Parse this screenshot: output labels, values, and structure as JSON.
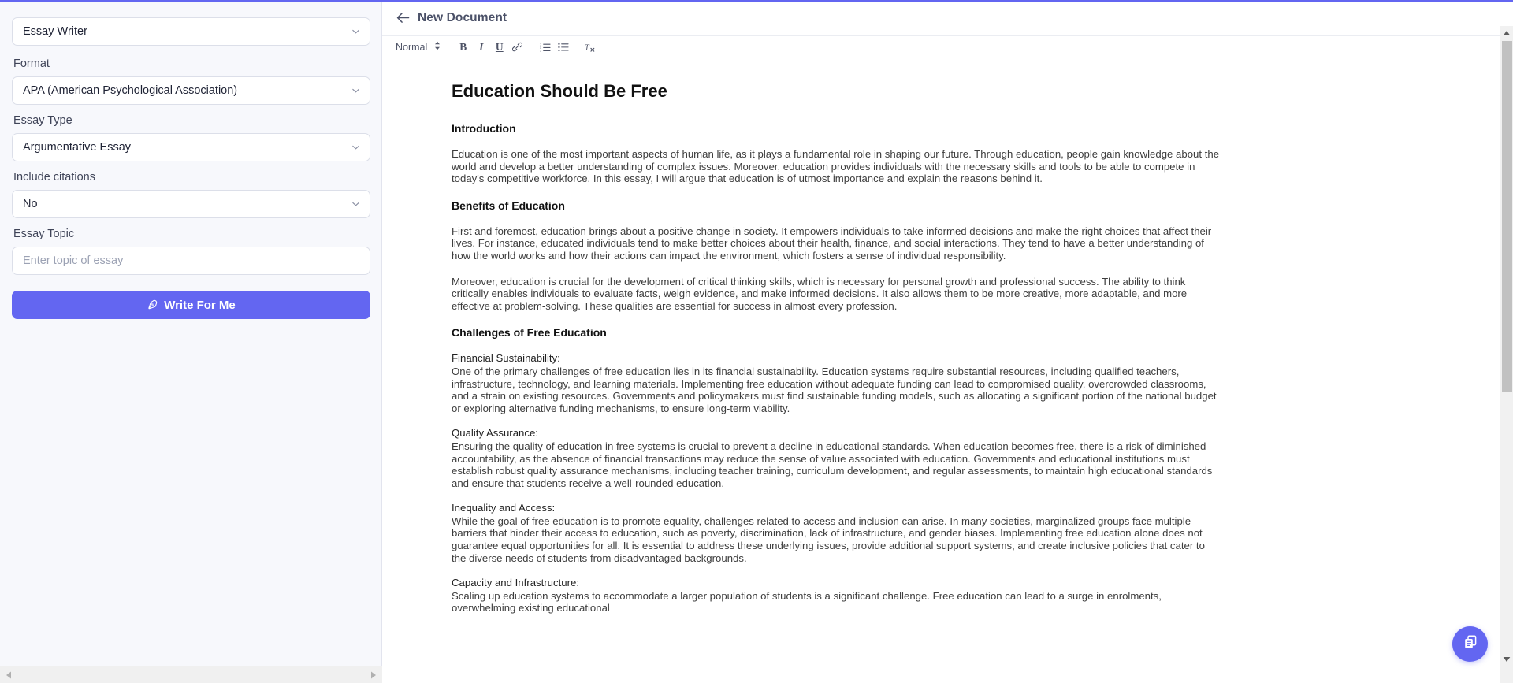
{
  "theme": {
    "accent": "#6366f1",
    "sidebar_bg": "#f7f8fc",
    "text": "#1f2335"
  },
  "sidebar": {
    "tool_select": {
      "value": "Essay Writer",
      "icon": "chevron-down-icon"
    },
    "fields": [
      {
        "label": "Format",
        "value": "APA (American Psychological Association)",
        "type": "select"
      },
      {
        "label": "Essay Type",
        "value": "Argumentative Essay",
        "type": "select"
      },
      {
        "label": "Include citations",
        "value": "No",
        "type": "select"
      }
    ],
    "topic": {
      "label": "Essay Topic",
      "value": "",
      "placeholder": "Enter topic of essay"
    },
    "submit": {
      "label": "Write For Me",
      "icon": "pen-nib-icon"
    },
    "scrollbar": {
      "left_arrow": "triangle-left-icon",
      "right_arrow": "triangle-right-icon"
    }
  },
  "editor": {
    "back_icon": "arrow-left-icon",
    "title": "New Document",
    "toolbar": {
      "style_value": "Normal",
      "style_icon": "updown-chevron-icon",
      "buttons": [
        {
          "name": "bold",
          "glyph": "B",
          "icon": "bold-icon"
        },
        {
          "name": "italic",
          "glyph": "I",
          "icon": "italic-icon"
        },
        {
          "name": "underline",
          "glyph": "U",
          "icon": "underline-icon"
        },
        {
          "name": "link",
          "glyph": "",
          "icon": "link-icon"
        },
        {
          "name": "ordered-list",
          "glyph": "",
          "icon": "ordered-list-icon"
        },
        {
          "name": "bullet-list",
          "glyph": "",
          "icon": "bullet-list-icon"
        },
        {
          "name": "clear-format",
          "glyph": "",
          "icon": "clear-format-icon"
        }
      ]
    }
  },
  "document": {
    "title": "Education Should Be Free",
    "sections": {
      "intro_heading": "Introduction",
      "intro_para": "Education is one of the most important aspects of human life, as it plays a fundamental role in shaping our future. Through education, people gain knowledge about the world and develop a better understanding of complex issues. Moreover, education provides individuals with the necessary skills and tools to be able to compete in today's competitive workforce. In this essay, I will argue that education is of utmost importance and explain the reasons behind it.",
      "benefits_heading": "Benefits of Education",
      "benefits_para_1": "First and foremost, education brings about a positive change in society. It empowers individuals to take informed decisions and make the right choices that affect their lives. For instance, educated individuals tend to make better choices about their health, finance, and social interactions. They tend to have a better understanding of how the world works and how their actions can impact the environment, which fosters a sense of individual responsibility.",
      "benefits_para_2": "Moreover, education is crucial for the development of critical thinking skills, which is necessary for personal growth and professional success. The ability to think critically enables individuals to evaluate facts, weigh evidence, and make informed decisions. It also allows them to be more creative, more adaptable, and more effective at problem-solving. These qualities are essential for success in almost every profession.",
      "challenges_heading": "Challenges of Free Education",
      "sub_1_title": "Financial Sustainability:",
      "sub_1_body": "One of the primary challenges of free education lies in its financial sustainability. Education systems require substantial resources, including qualified teachers, infrastructure, technology, and learning materials. Implementing free education without adequate funding can lead to compromised quality, overcrowded classrooms, and a strain on existing resources. Governments and policymakers must find sustainable funding models, such as allocating a significant portion of the national budget or exploring alternative funding mechanisms, to ensure long-term viability.",
      "sub_2_title": "Quality Assurance:",
      "sub_2_body": "Ensuring the quality of education in free systems is crucial to prevent a decline in educational standards. When education becomes free, there is a risk of diminished accountability, as the absence of financial transactions may reduce the sense of value associated with education. Governments and educational institutions must establish robust quality assurance mechanisms, including teacher training, curriculum development, and regular assessments, to maintain high educational standards and ensure that students receive a well-rounded education.",
      "sub_3_title": "Inequality and Access:",
      "sub_3_body": "While the goal of free education is to promote equality, challenges related to access and inclusion can arise. In many societies, marginalized groups face multiple barriers that hinder their access to education, such as poverty, discrimination, lack of infrastructure, and gender biases. Implementing free education alone does not guarantee equal opportunities for all. It is essential to address these underlying issues, provide additional support systems, and create inclusive policies that cater to the diverse needs of students from disadvantaged backgrounds.",
      "sub_4_title": "Capacity and Infrastructure:",
      "sub_4_body": "Scaling up education systems to accommodate a larger population of students is a significant challenge. Free education can lead to a surge in enrolments, overwhelming existing educational"
    }
  },
  "fab": {
    "icon": "copy-documents-icon"
  },
  "scrollbar": {
    "up_arrow": "triangle-up-icon",
    "down_arrow": "triangle-down-icon"
  }
}
